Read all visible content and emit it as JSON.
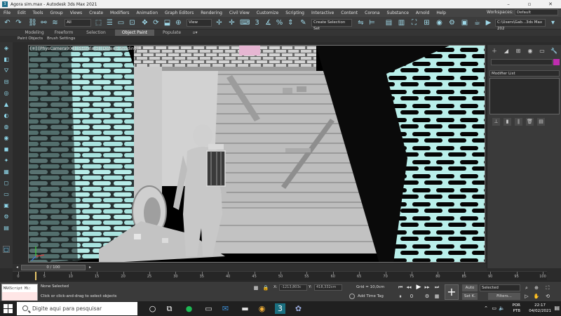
{
  "title_bar": {
    "title": "Agora sim.max - Autodesk 3ds Max 2021",
    "app_icon": "3ds-max-icon"
  },
  "menu": {
    "items": [
      "File",
      "Edit",
      "Tools",
      "Group",
      "Views",
      "Create",
      "Modifiers",
      "Animation",
      "Graph Editors",
      "Rendering",
      "Civil View",
      "Customize",
      "Scripting",
      "Interactive",
      "Content",
      "Corona",
      "Substance",
      "Arnold",
      "Help"
    ],
    "workspace_label": "Workspaces:",
    "workspace_value": "Default"
  },
  "toolbar": {
    "filter_select": "All",
    "view_select": "View",
    "selection_set": "Create Selection Set",
    "project_path": "C:\\Users\\Gab...3ds Max 202"
  },
  "ribbon": {
    "tabs": [
      "Modeling",
      "Freeform",
      "Selection",
      "Object Paint",
      "Populate"
    ],
    "active_tab": "Object Paint",
    "sub_items": [
      "Paint Objects",
      "Brush Settings"
    ]
  },
  "viewport": {
    "label": "[+] [PhysCamera004] [Standard] [Default Shading]"
  },
  "command_panel": {
    "modifier_list": "Modifier List",
    "color_swatch": "#c02db0"
  },
  "timeline": {
    "frame_display": "0 / 100",
    "ticks": [
      0,
      5,
      10,
      15,
      20,
      25,
      30,
      35,
      40,
      45,
      50,
      55,
      60,
      65,
      70,
      75,
      80,
      85,
      90,
      95,
      100
    ]
  },
  "status": {
    "maxscript_label": "MAXScript Mi:",
    "selection": "None Selected",
    "prompt": "Click or click-and-drag to select objects",
    "x_label": "X:",
    "x_value": "-1213,803c",
    "y_label": "Y:",
    "y_value": "418,332cm",
    "z_label": "Z:",
    "z_value": "0,0cm",
    "grid": "Grid = 10,0cm",
    "add_time_tag": "Add Time Tag",
    "auto_key": "Auto",
    "set_key": "Set K.",
    "selected_dd": "Selected",
    "filters": "Filters...",
    "current_frame": "0"
  },
  "taskbar": {
    "search_placeholder": "Digite aqui para pesquisar",
    "lang_top": "POR",
    "lang_bottom": "PTB",
    "time": "22:17",
    "date": "04/02/2021"
  }
}
